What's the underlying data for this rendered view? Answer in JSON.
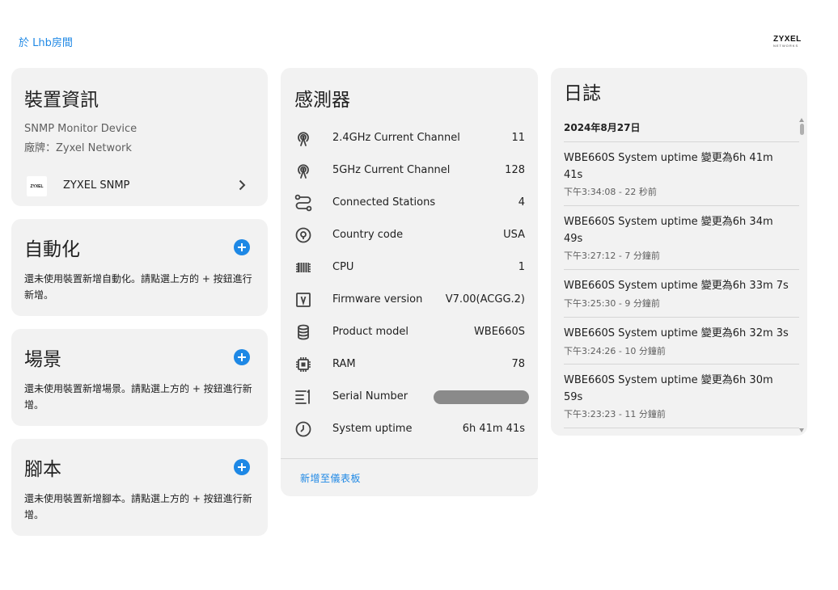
{
  "header": {
    "area_link": "於 Lhb房間",
    "brand_logo_text": "ZYXEL",
    "brand_logo_sub": "NETWORKS"
  },
  "device_info": {
    "title": "裝置資訊",
    "model_line": "SNMP Monitor Device",
    "brand_line": "廠牌：Zyxel Network",
    "integration": {
      "logo_text": "ZYXEL",
      "name": "ZYXEL SNMP"
    }
  },
  "automation": {
    "title": "自動化",
    "empty_text": "還未使用裝置新增自動化。請點選上方的 + 按鈕進行新增。"
  },
  "scenes": {
    "title": "場景",
    "empty_text": "還未使用裝置新增場景。請點選上方的 + 按鈕進行新增。"
  },
  "scripts": {
    "title": "腳本",
    "empty_text": "還未使用裝置新增腳本。請點選上方的 + 按鈕進行新增。"
  },
  "sensors": {
    "title": "感測器",
    "items": [
      {
        "name": "2.4GHz Current Channel",
        "value": "11",
        "icon": "antenna-icon"
      },
      {
        "name": "5GHz Current Channel",
        "value": "128",
        "icon": "antenna-icon"
      },
      {
        "name": "Connected Stations",
        "value": "4",
        "icon": "connections-icon"
      },
      {
        "name": "Country code",
        "value": "USA",
        "icon": "map-marker-icon"
      },
      {
        "name": "CPU",
        "value": "1",
        "icon": "memory-chip-icon"
      },
      {
        "name": "Firmware version",
        "value": "V7.00(ACGG.2)",
        "icon": "firmware-icon"
      },
      {
        "name": "Product model",
        "value": "WBE660S",
        "icon": "database-icon"
      },
      {
        "name": "RAM",
        "value": "78",
        "icon": "chip-icon"
      },
      {
        "name": "Serial Number",
        "value": "",
        "icon": "list-icon"
      },
      {
        "name": "System uptime",
        "value": "6h 41m 41s",
        "icon": "clock-icon"
      }
    ],
    "add_to_dashboard": "新增至儀表板"
  },
  "logbook": {
    "title": "日誌",
    "date": "2024年8月27日",
    "entries": [
      {
        "message": "WBE660S System uptime 變更為6h 41m 41s",
        "time": "下午3:34:08 - 22 秒前"
      },
      {
        "message": "WBE660S System uptime 變更為6h 34m 49s",
        "time": "下午3:27:12 - 7 分鐘前"
      },
      {
        "message": "WBE660S System uptime 變更為6h 33m 7s",
        "time": "下午3:25:30 - 9 分鐘前"
      },
      {
        "message": "WBE660S System uptime 變更為6h 32m 3s",
        "time": "下午3:24:26 - 10 分鐘前"
      },
      {
        "message": "WBE660S System uptime 變更為6h 30m 59s",
        "time": "下午3:23:23 - 11 分鐘前"
      }
    ]
  },
  "colors": {
    "accent": "#1e88e5",
    "card_background": "#f2f2f2",
    "redacted": "#8a8a8a"
  }
}
